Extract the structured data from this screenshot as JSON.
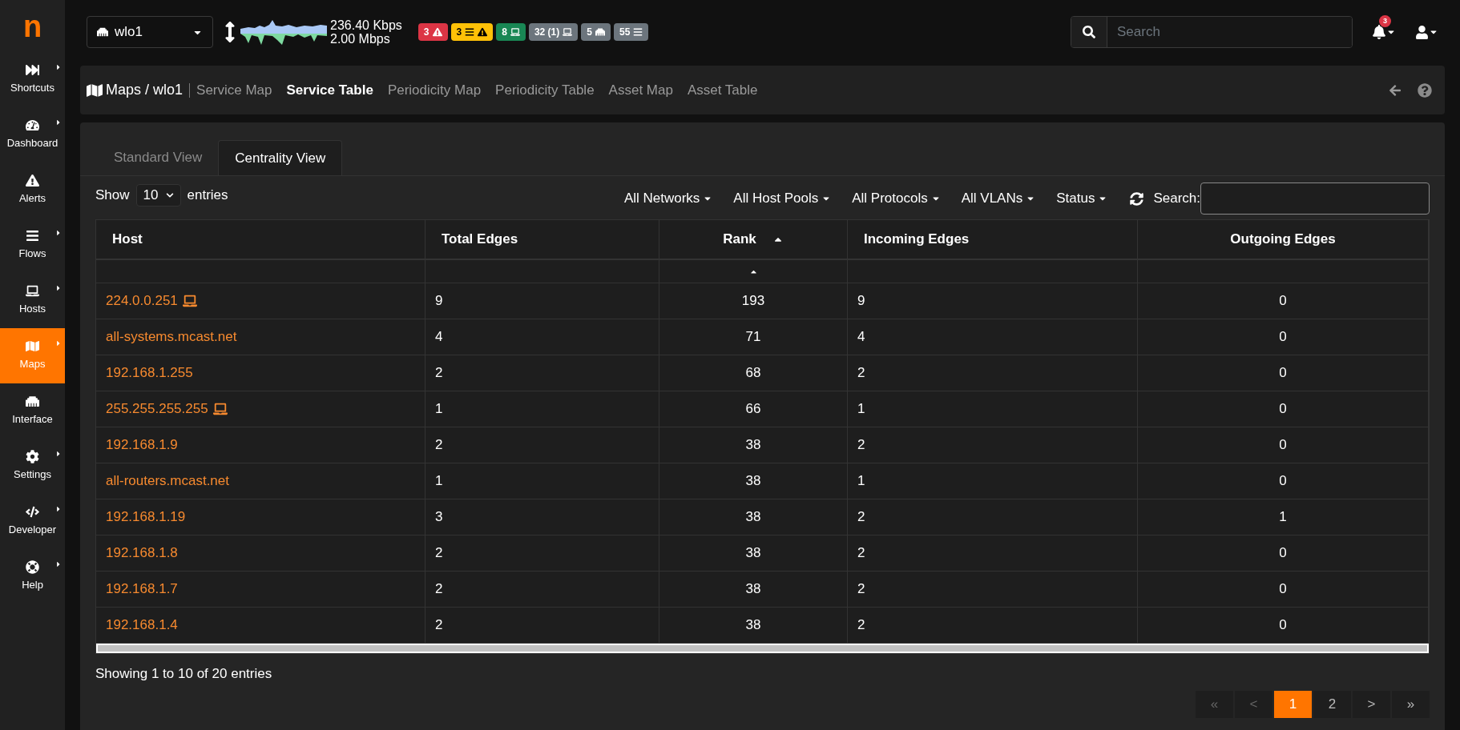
{
  "logo": "n",
  "sidebar": {
    "items": [
      {
        "label": "Shortcuts",
        "selected": false,
        "submenu": true
      },
      {
        "label": "Dashboard",
        "selected": false,
        "submenu": true
      },
      {
        "label": "Alerts",
        "selected": false,
        "submenu": false
      },
      {
        "label": "Flows",
        "selected": false,
        "submenu": true
      },
      {
        "label": "Hosts",
        "selected": false,
        "submenu": true
      },
      {
        "label": "Maps",
        "selected": true,
        "submenu": true
      },
      {
        "label": "Interface",
        "selected": false,
        "submenu": false
      },
      {
        "label": "Settings",
        "selected": false,
        "submenu": true
      },
      {
        "label": "Developer",
        "selected": false,
        "submenu": true
      },
      {
        "label": "Help",
        "selected": false,
        "submenu": true
      }
    ]
  },
  "topbar": {
    "interface": "wlo1",
    "rate_up": "236.40 Kbps",
    "rate_down": "2.00 Mbps",
    "badges": [
      {
        "text": "3",
        "color": "#dc3545"
      },
      {
        "text": "3",
        "color": "#ffc107"
      },
      {
        "text": "8",
        "color": "#198754"
      },
      {
        "text": "32 (1)",
        "color": "#6c757d"
      },
      {
        "text": "5",
        "color": "#6c757d"
      },
      {
        "text": "55",
        "color": "#6c757d"
      }
    ],
    "search": {
      "placeholder": "Search"
    },
    "notifications": "3"
  },
  "breadcrumb": {
    "title": "Maps / wlo1",
    "nav": [
      {
        "label": "Service Map",
        "selected": false
      },
      {
        "label": "Service Table",
        "selected": true
      },
      {
        "label": "Periodicity Map",
        "selected": false
      },
      {
        "label": "Periodicity Table",
        "selected": false
      },
      {
        "label": "Asset Map",
        "selected": false
      },
      {
        "label": "Asset Table",
        "selected": false
      }
    ]
  },
  "view_tabs": [
    {
      "label": "Standard View",
      "selected": false
    },
    {
      "label": "Centrality View",
      "selected": true
    }
  ],
  "length": {
    "before": "Show",
    "value": "10",
    "after": "entries"
  },
  "filters": [
    "All Networks",
    "All Host Pools",
    "All Protocols",
    "All VLANs",
    "Status"
  ],
  "search_label": "Search:",
  "table": {
    "columns": [
      {
        "label": "Host",
        "sorted": false
      },
      {
        "label": "Total Edges",
        "sorted": false
      },
      {
        "label": "Rank",
        "sorted": true
      },
      {
        "label": "Incoming Edges",
        "sorted": false
      },
      {
        "label": "Outgoing Edges",
        "sorted": false
      }
    ],
    "rows": [
      {
        "device_icon": true,
        "cells": [
          "224.0.0.251",
          "9",
          "193",
          "9",
          "0"
        ]
      },
      {
        "device_icon": false,
        "cells": [
          "all-systems.mcast.net",
          "4",
          "71",
          "4",
          "0"
        ]
      },
      {
        "device_icon": false,
        "cells": [
          "192.168.1.255",
          "2",
          "68",
          "2",
          "0"
        ]
      },
      {
        "device_icon": true,
        "cells": [
          "255.255.255.255",
          "1",
          "66",
          "1",
          "0"
        ]
      },
      {
        "device_icon": false,
        "cells": [
          "192.168.1.9",
          "2",
          "38",
          "2",
          "0"
        ]
      },
      {
        "device_icon": false,
        "cells": [
          "all-routers.mcast.net",
          "1",
          "38",
          "1",
          "0"
        ]
      },
      {
        "device_icon": false,
        "cells": [
          "192.168.1.19",
          "3",
          "38",
          "2",
          "1"
        ]
      },
      {
        "device_icon": false,
        "cells": [
          "192.168.1.8",
          "2",
          "38",
          "2",
          "0"
        ]
      },
      {
        "device_icon": false,
        "cells": [
          "192.168.1.7",
          "2",
          "38",
          "2",
          "0"
        ]
      },
      {
        "device_icon": false,
        "cells": [
          "192.168.1.4",
          "2",
          "38",
          "2",
          "0"
        ]
      }
    ]
  },
  "info": "Showing 1 to 10 of 20 entries",
  "pagination": [
    {
      "label": "«",
      "selected": false,
      "disabled": true
    },
    {
      "label": "<",
      "selected": false,
      "disabled": true
    },
    {
      "label": "1",
      "selected": true,
      "disabled": false
    },
    {
      "label": "2",
      "selected": false,
      "disabled": false
    },
    {
      "label": ">",
      "selected": false,
      "disabled": false
    },
    {
      "label": "»",
      "selected": false,
      "disabled": false
    }
  ]
}
